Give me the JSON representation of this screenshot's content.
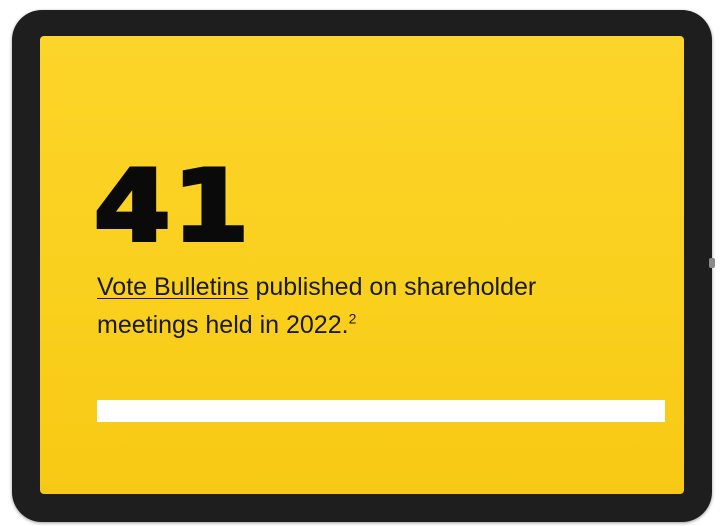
{
  "card": {
    "stat_value": "41",
    "link_text": "Vote Bulletins",
    "line1_rest": " published on shareholder",
    "line2_text": "meetings held in 2022.",
    "footnote_marker": "2",
    "progress_fraction": 1.0
  },
  "colors": {
    "screen_background": "#fad01e",
    "device_frame": "#1e1e1e",
    "text": "#1a1a1a",
    "progress_bar": "#ffffff"
  }
}
